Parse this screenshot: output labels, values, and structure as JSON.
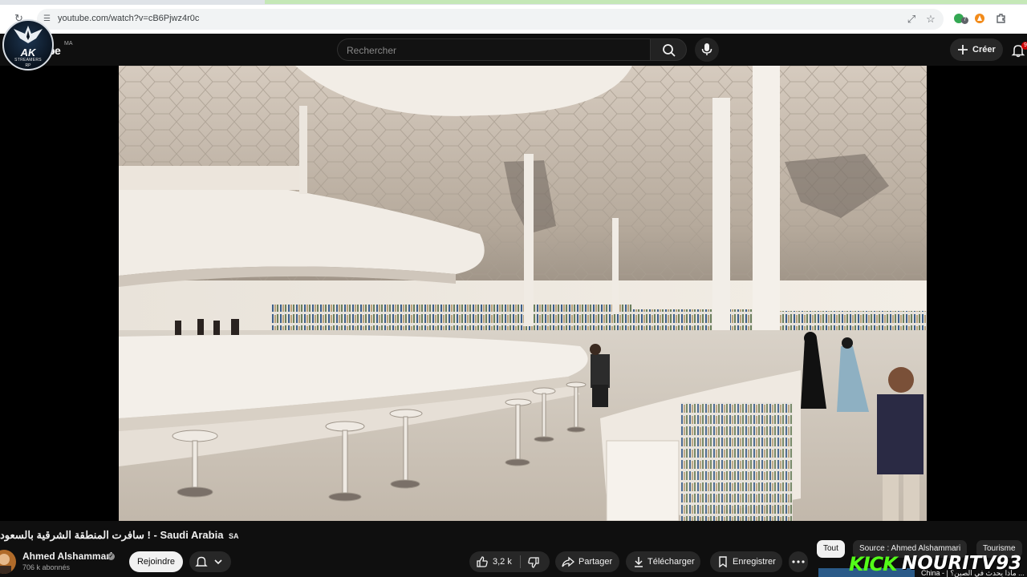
{
  "browser": {
    "url": "youtube.com/watch?v=cB6Pjwz4r0c",
    "extension_badge": "7"
  },
  "header": {
    "logo_partial": "be",
    "country_code": "MA",
    "search_placeholder": "Rechercher",
    "create_label": "Créer",
    "notification_count": "9"
  },
  "overlay_badge": {
    "text": "AK",
    "subtitle": "STREAMERS",
    "subtitle2": "RP"
  },
  "video": {
    "title_arabic": "سافرت المنطقة الشرقية بالسعود",
    "title_sep": "! -",
    "title_latin": "Saudi Arabia",
    "title_flag": "SA",
    "channel": "Ahmed Alshammari",
    "subscribers": "706 k abonnés",
    "join_label": "Rejoindre",
    "like_count": "3,2 k",
    "share_label": "Partager",
    "download_label": "Télécharger",
    "save_label": "Enregistrer"
  },
  "chips": [
    "Tout",
    "Source : Ahmed Alshammari",
    "Tourisme"
  ],
  "stream_overlay": {
    "kick_logo": "KICK",
    "username": "NOURITV93"
  },
  "recommendation": {
    "title": "China - | ماذا يحدث في الصين؟ ..."
  },
  "colors": {
    "background": "#0f0f0f",
    "pill": "#272727",
    "kick_green": "#53fc18",
    "notification_red": "#cc0000"
  }
}
